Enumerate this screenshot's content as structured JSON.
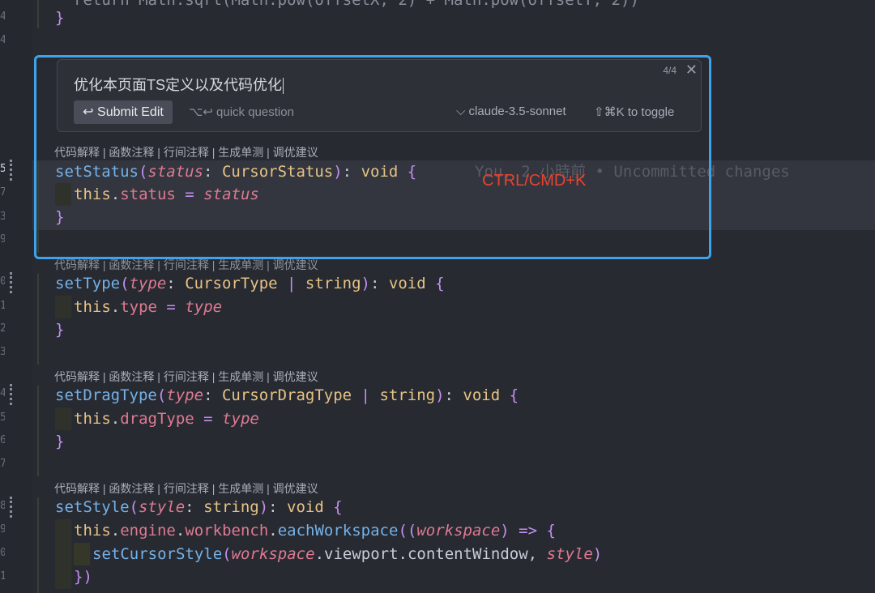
{
  "editor": {
    "top_partial_line": "return Math.sqrt(Math.pow(offsetX, 2) + Math.pow(offsetY, 2))",
    "close_brace": "}",
    "codelens": "代码解释 | 函数注释 | 行间注释 | 生成单测 | 调优建议",
    "line_numbers": [
      "4",
      "4",
      "5",
      "7",
      "3",
      "9",
      "0",
      "1",
      "2",
      "3",
      "4",
      "5",
      "6",
      "7",
      "8",
      "9",
      "0",
      "1"
    ],
    "blame": "You, 2 小時前 • Uncommitted changes"
  },
  "ai_panel": {
    "prompt": "优化本页面TS定义以及代码优化",
    "counter": "4/4",
    "close_icon": "✕",
    "submit_label": "Submit Edit",
    "submit_icon": "↩",
    "quick_question": "⌥↩ quick question",
    "model": "claude-3.5-sonnet",
    "model_chevron": "⌵",
    "toggle_hint": "⇧⌘K to toggle"
  },
  "annotation": "CTRL/CMD+K",
  "methods": [
    {
      "name": "setStatus",
      "param": "status",
      "type": "CursorStatus",
      "extra": "",
      "field": "status",
      "value": "status"
    },
    {
      "name": "setType",
      "param": "type",
      "type": "CursorType",
      "extra": "string",
      "field": "type",
      "value": "type"
    },
    {
      "name": "setDragType",
      "param": "type",
      "type": "CursorDragType",
      "extra": "string",
      "field": "dragType",
      "value": "type"
    },
    {
      "name": "setStyle",
      "param": "style",
      "type": "string",
      "extra": "",
      "field": "engine",
      "value": "workbench"
    }
  ],
  "style_body": {
    "call": "eachWorkspace",
    "arg": "workspace",
    "inner_fn": "setCursorStyle",
    "inner_arg1_obj": "workspace",
    "inner_arg1_rest": ".viewport.contentWindow",
    "inner_arg2": "style",
    "closing": "})"
  },
  "colors": {
    "accent": "#3ea3ee",
    "annotation": "#e8432f"
  }
}
